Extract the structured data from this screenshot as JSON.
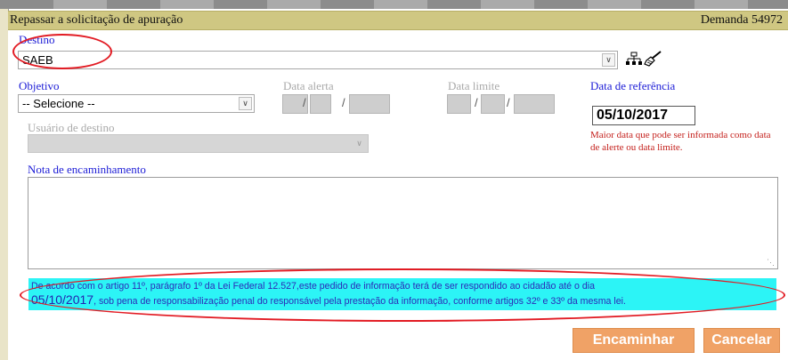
{
  "title": "Repassar a solicitação de apuração",
  "demanda": "Demanda 54972",
  "destino": {
    "label": "Destino",
    "value": "SAEB"
  },
  "objetivo": {
    "label": "Objetivo",
    "value": "-- Selecione --"
  },
  "data_alerta": {
    "label": "Data alerta",
    "day": "",
    "month": "",
    "year": ""
  },
  "data_limite": {
    "label": "Data limite",
    "day": "",
    "month": "",
    "year": ""
  },
  "data_referencia": {
    "label": "Data de referência",
    "value": "05/10/2017"
  },
  "hint": "Maior data que pode ser informada como data de alerte ou data limite.",
  "usuario_destino": {
    "label": "Usuário de destino",
    "value": ""
  },
  "nota": {
    "label": "Nota de encaminhamento",
    "value": ""
  },
  "legal": {
    "part1": "De acordo com o artigo 11º, parágrafo 1º da Lei Federal 12.527,este pedido de informação terá de ser respondido ao cidadão até o dia",
    "date": "05/10/2017",
    "part2": ", sob pena de responsabilização penal do responsável pela prestação da informação, conforme artigos 32º e 33º da mesma lei."
  },
  "buttons": {
    "encaminhar": "Encaminhar",
    "cancelar": "Cancelar"
  },
  "icons": {
    "org_chart": "org-chart-icon",
    "clear": "broom-icon"
  },
  "colors": {
    "titlebar": "#cfc782",
    "label_blue": "#1c1cd6",
    "highlight": "#2cf4f6",
    "button": "#f0a266",
    "annotation_red": "#e21b23"
  }
}
